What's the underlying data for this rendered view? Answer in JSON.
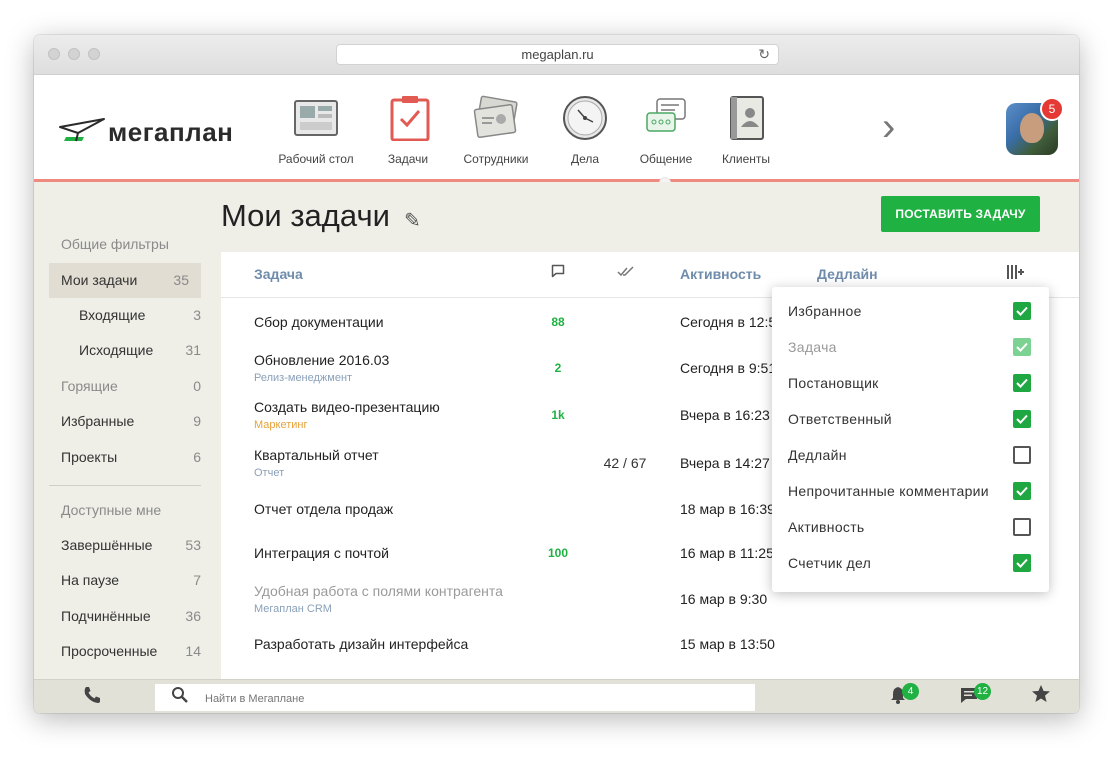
{
  "browser": {
    "url": "megaplan.ru"
  },
  "header": {
    "logo_text": "мегаплан",
    "nav": [
      {
        "label": "Рабочий стол"
      },
      {
        "label": "Задачи"
      },
      {
        "label": "Сотрудники"
      },
      {
        "label": "Дела"
      },
      {
        "label": "Общение"
      },
      {
        "label": "Клиенты"
      }
    ],
    "avatar_badge": "5"
  },
  "sidebar": {
    "general_heading": "Общие фильтры",
    "items": [
      {
        "label": "Мои задачи",
        "count": "35"
      },
      {
        "label": "Входящие",
        "count": "3"
      },
      {
        "label": "Исходящие",
        "count": "31"
      },
      {
        "label": "Горящие",
        "count": "0"
      },
      {
        "label": "Избранные",
        "count": "9"
      },
      {
        "label": "Проекты",
        "count": "6"
      }
    ],
    "available_heading": "Доступные мне",
    "items2": [
      {
        "label": "Завершённые",
        "count": "53"
      },
      {
        "label": "На паузе",
        "count": "7"
      },
      {
        "label": "Подчинённые",
        "count": "36"
      },
      {
        "label": "Просроченные",
        "count": "14"
      }
    ]
  },
  "page": {
    "title": "Мои задачи",
    "add_button": "ПОСТАВИТЬ ЗАДАЧУ"
  },
  "table": {
    "columns": {
      "task": "Задача",
      "activity": "Активность",
      "deadline": "Дедлайн"
    },
    "rows": [
      {
        "title": "Сбор документации",
        "subtitle": "",
        "comments": "88",
        "checklist": "",
        "activity": "Сегодня в 12:5"
      },
      {
        "title": "Обновление 2016.03",
        "subtitle": "Релиз-менеджмент",
        "comments": "2",
        "checklist": "",
        "activity": "Сегодня в 9:51"
      },
      {
        "title": "Создать видео-презентацию",
        "subtitle": "Маркетинг",
        "comments": "1k",
        "checklist": "",
        "activity": "Вчера в 16:23"
      },
      {
        "title": "Квартальный отчет",
        "subtitle": "Отчет",
        "comments": "",
        "checklist": "42 / 67",
        "activity": "Вчера в 14:27"
      },
      {
        "title": "Отчет отдела продаж",
        "subtitle": "",
        "comments": "",
        "checklist": "",
        "activity": "18 мар в 16:39"
      },
      {
        "title": "Интеграция с почтой",
        "subtitle": "",
        "comments": "100",
        "checklist": "",
        "activity": "16 мар в 11:25"
      },
      {
        "title": "Удобная работа с полями контрагента",
        "subtitle": "Мегаплан CRM",
        "comments": "",
        "checklist": "",
        "activity": "16 мар в 9:30"
      },
      {
        "title": "Разработать дизайн интерфейса",
        "subtitle": "",
        "comments": "",
        "checklist": "",
        "activity": "15 мар в 13:50"
      }
    ]
  },
  "column_menu": {
    "items": [
      {
        "label": "Избранное",
        "checked": true
      },
      {
        "label": "Задача",
        "checked": true,
        "disabled": true
      },
      {
        "label": "Постановщик",
        "checked": true
      },
      {
        "label": "Ответственный",
        "checked": true
      },
      {
        "label": "Дедлайн",
        "checked": false
      },
      {
        "label": "Непрочитанные комментарии",
        "checked": true
      },
      {
        "label": "Активность",
        "checked": false
      },
      {
        "label": "Счетчик дел",
        "checked": true
      }
    ]
  },
  "bottom": {
    "search_placeholder": "Найти в Мегаплане",
    "notifications_count": "4",
    "messages_count": "12"
  },
  "colors": {
    "accent": "#1fb141",
    "header_line": "#ef8a80",
    "link": "#6f8cab"
  }
}
